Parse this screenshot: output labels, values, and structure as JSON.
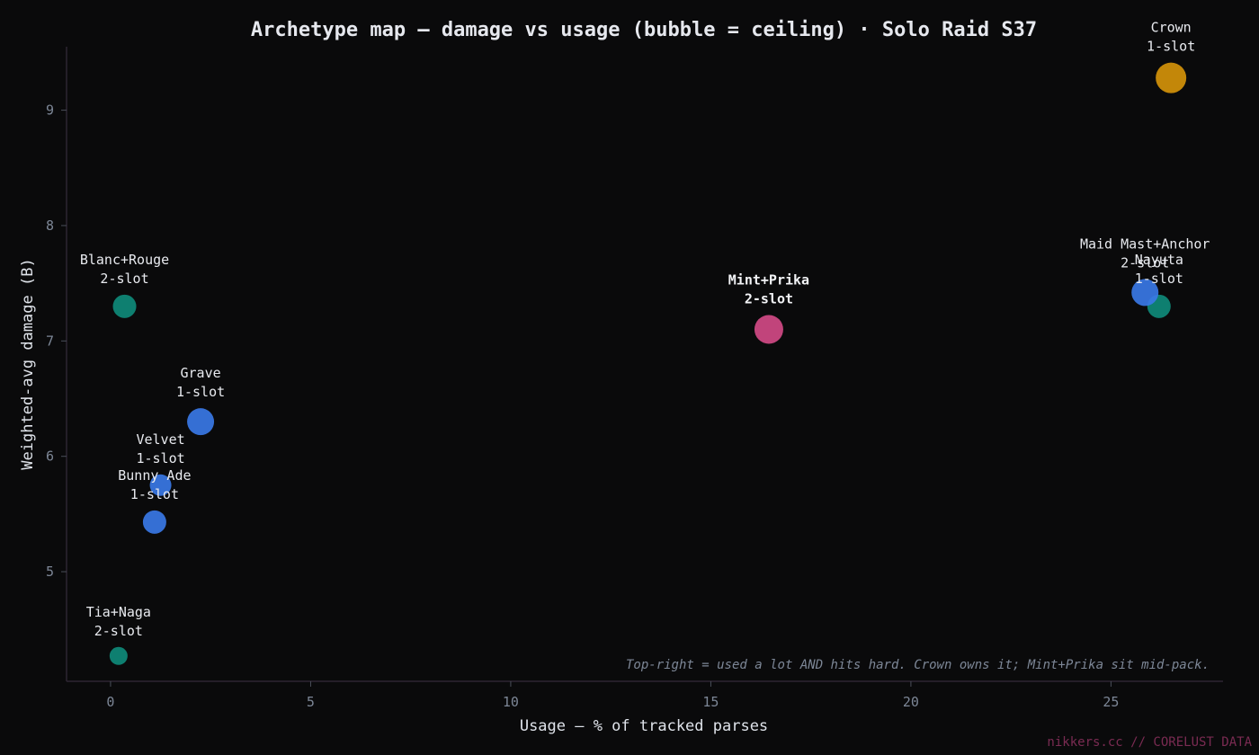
{
  "chart_data": {
    "type": "scatter",
    "title": "Archetype map — damage vs usage (bubble = ceiling)  ·  Solo Raid S37",
    "xlabel": "Usage — % of tracked parses",
    "ylabel": "Weighted-avg damage (B)",
    "xlim": [
      -1.1,
      27.8
    ],
    "ylim": [
      4.05,
      9.55
    ],
    "xticks": [
      0,
      5,
      10,
      15,
      20,
      25
    ],
    "yticks": [
      5,
      6,
      7,
      8,
      9
    ],
    "grid": false,
    "legend": "none",
    "points": [
      {
        "name": "Crown",
        "slot": "1-slot",
        "x": 26.5,
        "y": 9.28,
        "ceiling": 17,
        "color": "#d4920a",
        "highlight": false
      },
      {
        "name": "Blanc+Rouge",
        "slot": "2-slot",
        "x": 0.35,
        "y": 7.3,
        "ceiling": 13,
        "color": "#0f8a79",
        "highlight": false
      },
      {
        "name": "Mint+Prika",
        "slot": "2-slot",
        "x": 16.45,
        "y": 7.1,
        "ceiling": 16,
        "color": "#d14a86",
        "highlight": true
      },
      {
        "name": "Nayuta",
        "slot": "1-slot",
        "x": 26.2,
        "y": 7.3,
        "ceiling": 13,
        "color": "#0f8a79",
        "highlight": false
      },
      {
        "name": "Maid Mast+Anchor",
        "slot": "2-slot",
        "x": 25.85,
        "y": 7.42,
        "ceiling": 15,
        "color": "#3a78e6",
        "highlight": false
      },
      {
        "name": "Grave",
        "slot": "1-slot",
        "x": 2.25,
        "y": 6.3,
        "ceiling": 15,
        "color": "#3a78e6",
        "highlight": false
      },
      {
        "name": "Velvet",
        "slot": "1-slot",
        "x": 1.25,
        "y": 5.75,
        "ceiling": 12,
        "color": "#3a78e6",
        "highlight": false
      },
      {
        "name": "Bunny Ade",
        "slot": "1-slot",
        "x": 1.1,
        "y": 5.43,
        "ceiling": 13,
        "color": "#3a78e6",
        "highlight": false
      },
      {
        "name": "Tia+Naga",
        "slot": "2-slot",
        "x": 0.2,
        "y": 4.27,
        "ceiling": 10,
        "color": "#0f8a79",
        "highlight": false
      }
    ],
    "annotation": "Top-right = used a lot AND hits hard. Crown owns it; Mint+Prika sit mid-pack."
  },
  "credit": "nikkers.cc // CORELUST DATA"
}
